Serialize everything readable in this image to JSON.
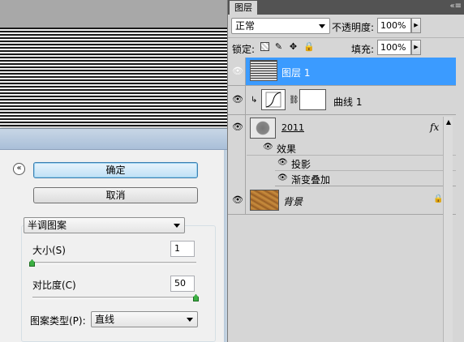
{
  "layers_panel": {
    "tab_label": "图层",
    "menu_icon": "«≡",
    "blend_mode": "正常",
    "opacity_label": "不透明度:",
    "opacity_value": "100%",
    "lock_label": "锁定:",
    "fill_label": "填充:",
    "fill_value": "100%",
    "layers": [
      {
        "name": "图层 1",
        "selected": true
      },
      {
        "name": "曲线 1",
        "selected": false
      },
      {
        "name": "2011",
        "selected": false,
        "fx": "fx"
      },
      {
        "name": "背景",
        "selected": false
      }
    ],
    "effects": {
      "label": "效果",
      "items": [
        "投影",
        "渐变叠加"
      ]
    }
  },
  "dialog": {
    "ok_label": "确定",
    "cancel_label": "取消",
    "collapse_icon": "«",
    "pattern_select": "半调图案",
    "size_label": "大小(S)",
    "size_value": "1",
    "size_level_percent": 0,
    "contrast_label": "对比度(C)",
    "contrast_value": "50",
    "contrast_level_percent": 100,
    "pattern_type_label": "图案类型(P):",
    "pattern_type_value": "直线"
  }
}
